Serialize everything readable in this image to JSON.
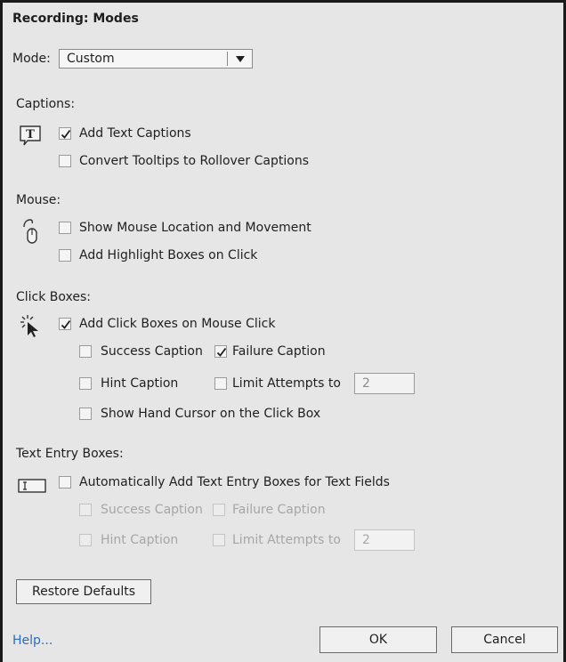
{
  "title": "Recording: Modes",
  "mode": {
    "label": "Mode:",
    "value": "Custom"
  },
  "captions": {
    "heading": "Captions:",
    "icon": "caption-icon",
    "add_text_captions": {
      "label": "Add Text Captions",
      "checked": true
    },
    "convert_tooltips": {
      "label": "Convert Tooltips to Rollover Captions",
      "checked": false
    }
  },
  "mouse": {
    "heading": "Mouse:",
    "icon": "mouse-icon",
    "show_location": {
      "label": "Show Mouse Location and Movement",
      "checked": false
    },
    "add_highlight": {
      "label": "Add Highlight Boxes on Click",
      "checked": false
    }
  },
  "click_boxes": {
    "heading": "Click Boxes:",
    "icon": "click-cursor-icon",
    "add_click_boxes": {
      "label": "Add Click Boxes on Mouse Click",
      "checked": true
    },
    "success_caption": {
      "label": "Success Caption",
      "checked": false
    },
    "failure_caption": {
      "label": "Failure Caption",
      "checked": true
    },
    "hint_caption": {
      "label": "Hint Caption",
      "checked": false
    },
    "limit_attempts": {
      "label": "Limit Attempts to",
      "checked": false,
      "value": "2"
    },
    "show_hand_cursor": {
      "label": "Show Hand Cursor on the Click Box",
      "checked": false
    }
  },
  "text_entry": {
    "heading": "Text Entry Boxes:",
    "icon": "text-field-icon",
    "auto_add": {
      "label": "Automatically Add Text Entry Boxes for Text Fields",
      "checked": false
    },
    "success_caption": {
      "label": "Success Caption",
      "checked": false
    },
    "failure_caption": {
      "label": "Failure Caption",
      "checked": false
    },
    "hint_caption": {
      "label": "Hint Caption",
      "checked": false
    },
    "limit_attempts": {
      "label": "Limit Attempts to",
      "checked": false,
      "value": "2"
    }
  },
  "buttons": {
    "restore_defaults": "Restore Defaults",
    "ok": "OK",
    "cancel": "Cancel",
    "help": "Help..."
  },
  "colors": {
    "background": "#e6e6e6",
    "link": "#2e6cb8",
    "disabled_text": "#a6a6a6"
  }
}
